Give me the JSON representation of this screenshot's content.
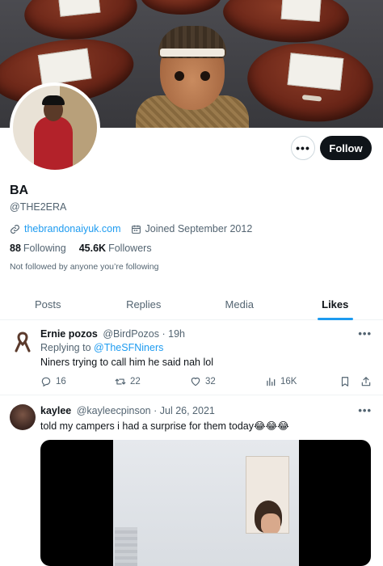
{
  "profile": {
    "display_name": "BA",
    "handle": "@THE2ERA",
    "website": "thebrandonaiyuk.com",
    "joined": "Joined September 2012",
    "following_count": "88",
    "following_label": "Following",
    "followers_count": "45.6K",
    "followers_label": "Followers",
    "not_followed_text": "Not followed by anyone you’re following",
    "follow_button": "Follow",
    "more_button": "•••"
  },
  "tabs": [
    {
      "label": "Posts",
      "active": false
    },
    {
      "label": "Replies",
      "active": false
    },
    {
      "label": "Media",
      "active": false
    },
    {
      "label": "Likes",
      "active": true
    }
  ],
  "tweets": [
    {
      "author": "Ernie pozos",
      "handle": "@BirdPozos",
      "time": "· 19h",
      "reply_prefix": "Replying to",
      "reply_to": "@TheSFNiners",
      "text": "Niners trying to call him he said nah lol",
      "replies": "16",
      "retweets": "22",
      "likes": "32",
      "views": "16K",
      "more": "•••"
    },
    {
      "author": "kaylee",
      "handle": "@kayleecpinson",
      "time": "· Jul 26, 2021",
      "text": "told my campers i had a surprise for them today😂😂😂",
      "more": "•••"
    }
  ],
  "colors": {
    "accent": "#1d9bf0",
    "text": "#0f1419",
    "secondary": "#536471",
    "follow_button_bg": "#0f1419"
  },
  "icons": [
    "link-icon",
    "calendar-icon",
    "reply-icon",
    "retweet-icon",
    "heart-icon",
    "views-icon",
    "bookmark-icon",
    "share-icon",
    "ribbon-icon"
  ]
}
